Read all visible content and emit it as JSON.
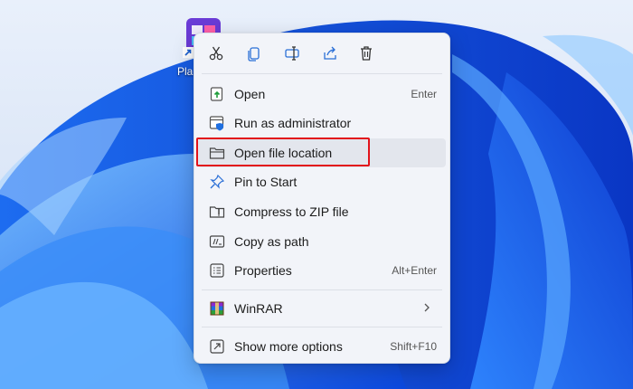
{
  "desktop_icon": {
    "label": "Pla"
  },
  "toolbar": {
    "buttons": [
      {
        "name": "cut",
        "icon": "scissors-icon"
      },
      {
        "name": "copy",
        "icon": "copy-icon"
      },
      {
        "name": "rename",
        "icon": "rename-icon"
      },
      {
        "name": "share",
        "icon": "share-icon"
      },
      {
        "name": "delete",
        "icon": "trash-icon"
      }
    ]
  },
  "menu": {
    "open": {
      "label": "Open",
      "shortcut": "Enter",
      "icon": "open-icon"
    },
    "run_as_admin": {
      "label": "Run as administrator",
      "icon": "shield-window-icon"
    },
    "open_file_location": {
      "label": "Open file location",
      "icon": "folder-icon"
    },
    "pin_to_start": {
      "label": "Pin to Start",
      "icon": "pin-icon"
    },
    "compress_zip": {
      "label": "Compress to ZIP file",
      "icon": "zip-folder-icon"
    },
    "copy_as_path": {
      "label": "Copy as path",
      "icon": "path-icon"
    },
    "properties": {
      "label": "Properties",
      "shortcut": "Alt+Enter",
      "icon": "properties-icon"
    },
    "winrar": {
      "label": "WinRAR",
      "icon": "winrar-icon"
    },
    "show_more": {
      "label": "Show more options",
      "shortcut": "Shift+F10",
      "icon": "more-options-icon"
    }
  },
  "colors": {
    "wallpaper_deep": "#0a3fd6",
    "wallpaper_light": "#4aa0f5",
    "menu_background": "#f2f4f9",
    "highlight_border": "#e2131b"
  }
}
